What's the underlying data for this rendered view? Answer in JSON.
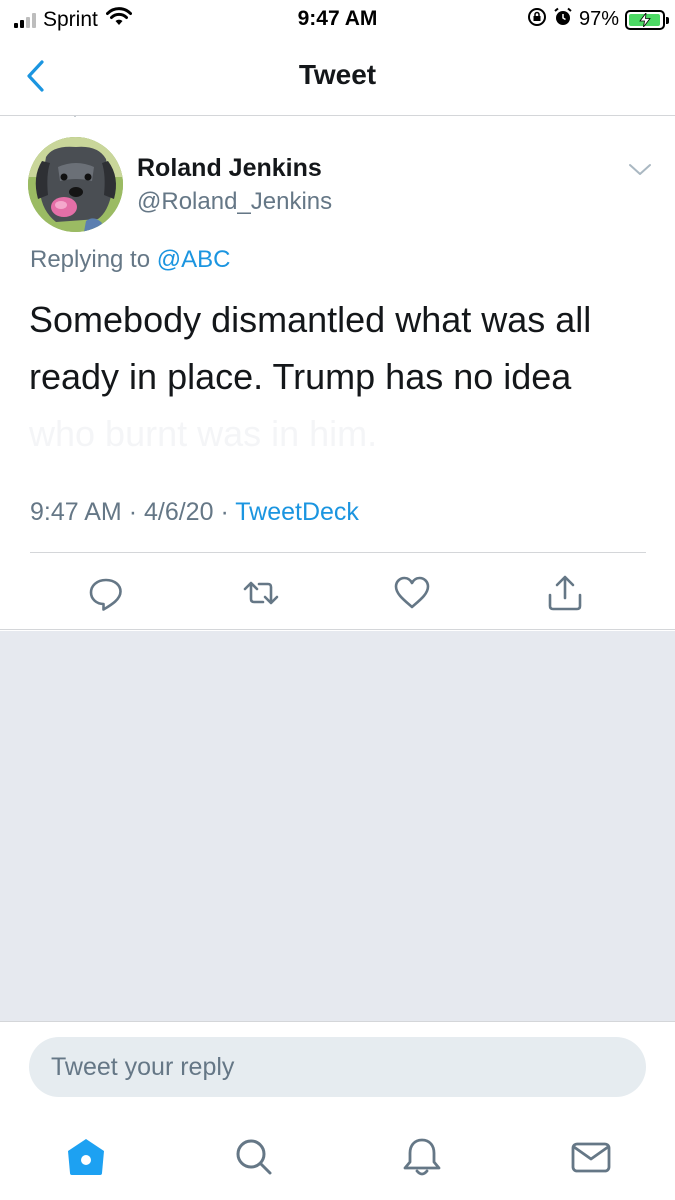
{
  "status_bar": {
    "carrier": "Sprint",
    "time": "9:47 AM",
    "battery_percent": "97%",
    "battery_level": 0.97,
    "icons": [
      "signal-icon",
      "wifi-icon",
      "orientation-lock-icon",
      "alarm-icon",
      "battery-icon"
    ]
  },
  "nav": {
    "title": "Tweet",
    "back_icon": "chevron-left-icon"
  },
  "tweet": {
    "author_name": "Roland Jenkins",
    "author_handle": "@Roland_Jenkins",
    "replying_to_label": "Replying to",
    "replying_to_handle": "@ABC",
    "text_line1": "Somebody dismantled what was all",
    "text_line2": "ready in place.  Trump has no idea",
    "text_line3": "who burnt was in him.",
    "time": "9:47 AM",
    "separator": "·",
    "date": "4/6/20",
    "source": "TweetDeck",
    "action_icons": [
      "reply-icon",
      "retweet-icon",
      "like-icon",
      "share-icon"
    ]
  },
  "composer": {
    "placeholder": "Tweet your reply"
  },
  "tab_bar": {
    "icons": [
      "home-icon",
      "search-icon",
      "notifications-icon",
      "messages-icon"
    ],
    "active": "home-icon"
  },
  "colors": {
    "link_blue": "#1b95e0",
    "secondary_text": "#657786",
    "background_gray": "#e6e9ef",
    "battery_green": "#4cd964"
  }
}
